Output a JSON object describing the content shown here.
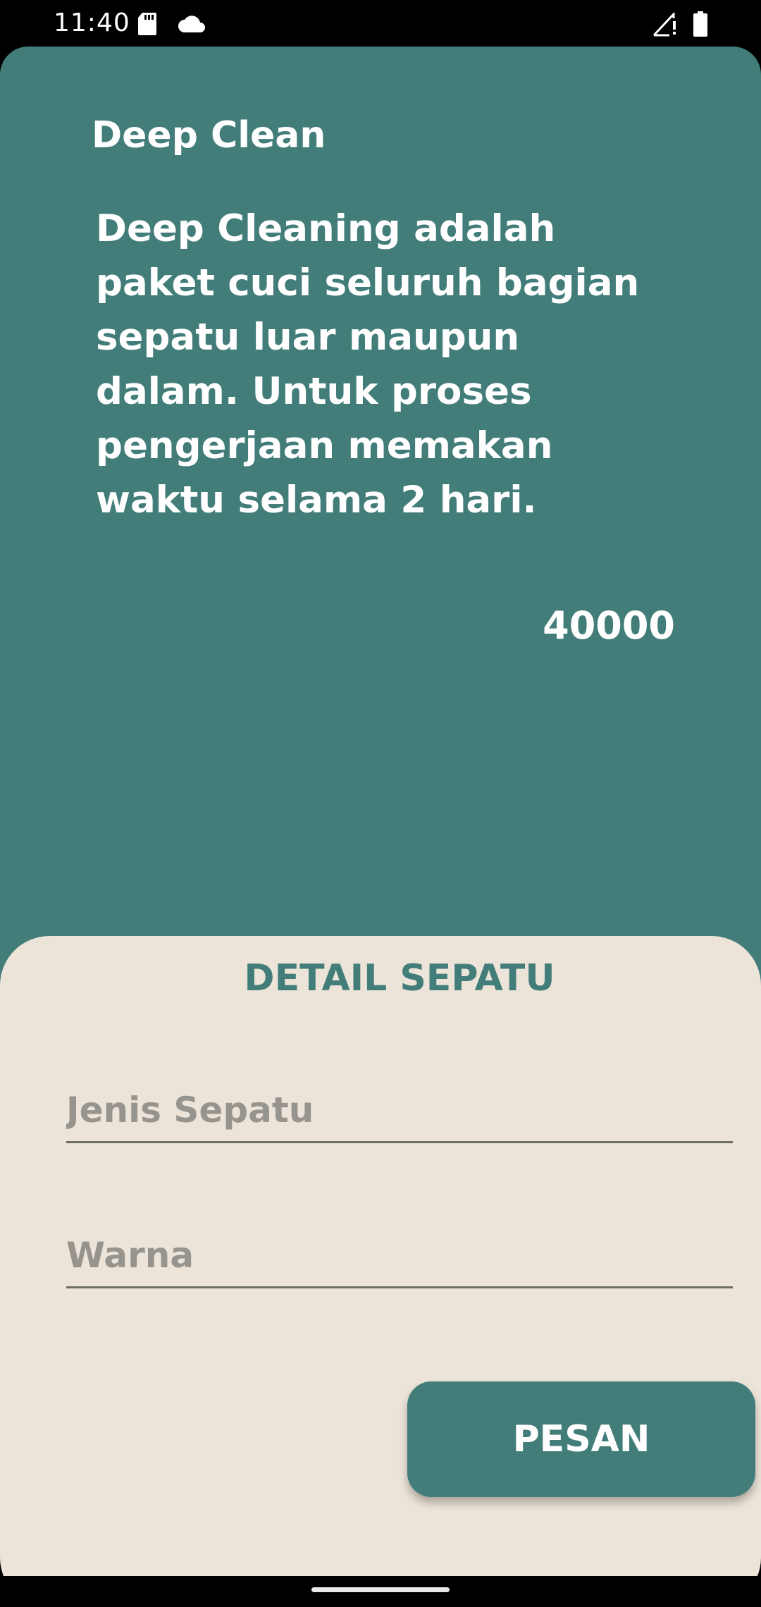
{
  "status_bar": {
    "time": "11:40",
    "icons": [
      "sd-card-icon",
      "cloud-icon",
      "signal-icon",
      "battery-icon"
    ]
  },
  "service": {
    "title": "Deep Clean",
    "description": "Deep Cleaning adalah paket cuci seluruh bagian sepatu luar maupun dalam. Untuk proses pengerjaan memakan waktu selama 2 hari.",
    "price": "40000"
  },
  "detail_form": {
    "title": "DETAIL SEPATU",
    "shoe_type_placeholder": "Jenis Sepatu",
    "shoe_type_value": "",
    "color_placeholder": "Warna",
    "color_value": "",
    "order_button_label": "PESAN"
  },
  "colors": {
    "primary": "#427d79",
    "sheet_background": "#ece4d9",
    "placeholder": "#97948d"
  }
}
